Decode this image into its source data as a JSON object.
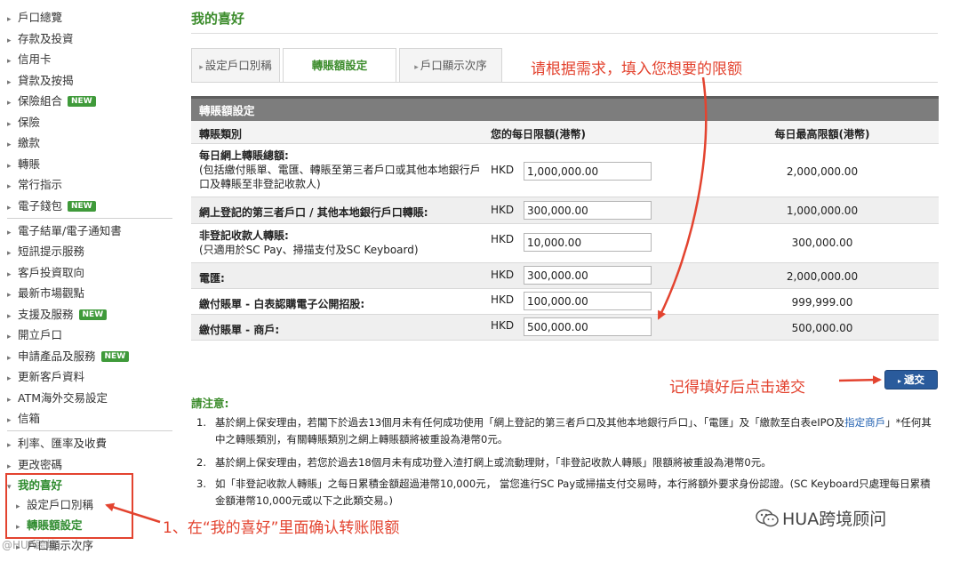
{
  "sidebar": {
    "items": [
      {
        "label": "戶口總覽"
      },
      {
        "label": "存款及投資"
      },
      {
        "label": "信用卡"
      },
      {
        "label": "貸款及按揭"
      },
      {
        "label": "保險組合",
        "badge": "NEW"
      },
      {
        "label": "保險"
      },
      {
        "label": "繳款"
      },
      {
        "label": "轉賬"
      },
      {
        "label": "常行指示"
      },
      {
        "label": "電子錢包",
        "badge": "NEW"
      },
      {
        "label": "電子結單/電子通知書"
      },
      {
        "label": "短訊提示服務"
      },
      {
        "label": "客戶投資取向"
      },
      {
        "label": "最新市場觀點"
      },
      {
        "label": "支援及服務",
        "badge": "NEW"
      },
      {
        "label": "開立戶口"
      },
      {
        "label": "申請產品及服務",
        "badge": "NEW"
      },
      {
        "label": "更新客戶資料"
      },
      {
        "label": "ATM海外交易設定"
      },
      {
        "label": "信箱"
      },
      {
        "label": "利率、匯率及收費"
      },
      {
        "label": "更改密碼"
      },
      {
        "label": "我的喜好"
      }
    ],
    "sub_items": [
      {
        "label": "設定戶口別稱"
      },
      {
        "label": "轉賬額設定"
      },
      {
        "label": "戶口顯示次序"
      }
    ]
  },
  "page": {
    "title": "我的喜好",
    "tabs": [
      {
        "label": "設定戶口別稱"
      },
      {
        "label": "轉賬額設定"
      },
      {
        "label": "戶口顯示次序"
      }
    ]
  },
  "table": {
    "heading": "轉賬額設定",
    "columns": {
      "type": "轉賬類別",
      "daily": "您的每日限額(港幣)",
      "max": "每日最高限額(港幣)"
    },
    "currency": "HKD",
    "rows": [
      {
        "title": "每日網上轉賬總額:",
        "desc": "(包括繳付賬單、電匯、轉賬至第三者戶口或其他本地銀行戶口及轉賬至非登記收款人)",
        "value": "1,000,000.00",
        "max": "2,000,000.00"
      },
      {
        "title": "網上登記的第三者戶口 / 其他本地銀行戶口轉賬:",
        "desc": "",
        "value": "300,000.00",
        "max": "1,000,000.00"
      },
      {
        "title": "非登記收款人轉賬:",
        "desc": "(只適用於SC Pay、掃描支付及SC Keyboard)",
        "value": "10,000.00",
        "max": "300,000.00"
      },
      {
        "title": "電匯:",
        "desc": "",
        "value": "300,000.00",
        "max": "2,000,000.00"
      },
      {
        "title": "繳付賬單 - 白表認購電子公開招股:",
        "desc": "",
        "value": "100,000.00",
        "max": "999,999.00"
      },
      {
        "title": "繳付賬單 - 商戶:",
        "desc": "",
        "value": "500,000.00",
        "max": "500,000.00"
      }
    ]
  },
  "submit": {
    "label": "遞交"
  },
  "notes": {
    "title": "請注意:",
    "items": [
      {
        "num": "1.",
        "text_a": "基於網上保安理由，若閣下於過去13個月未有任何成功使用「網上登記的第三者戶口及其他本地銀行戶口」、「電匯」及「繳款至白表eIPO及",
        "link": "指定商戶",
        "text_b": "」*任何其中之轉賬類別，有關轉賬類別之網上轉賬額將被重設為港幣0元。"
      },
      {
        "num": "2.",
        "text": "基於網上保安理由，若您於過去18個月未有成功登入渣打網上或流動理財，「非登記收款人轉賬」限額將被重設為港幣0元。"
      },
      {
        "num": "3.",
        "text": "如「非登記收款人轉賬」之每日累積金額超過港幣10,000元，  當您進行SC Pay或掃描支付交易時，本行將額外要求身份認證。(SC Keyboard只處理每日累積金額港幣10,000元或以下之此類交易。)"
      }
    ]
  },
  "annotations": {
    "top": "请根据需求，填入您想要的限额",
    "submit_hint": "记得填好后点击递交",
    "step1": "1、在“我的喜好”里面确认转账限额",
    "color": "#e3432f"
  },
  "watermark": {
    "text": "HUA跨境顾问",
    "corner": "@HUA跨境"
  }
}
